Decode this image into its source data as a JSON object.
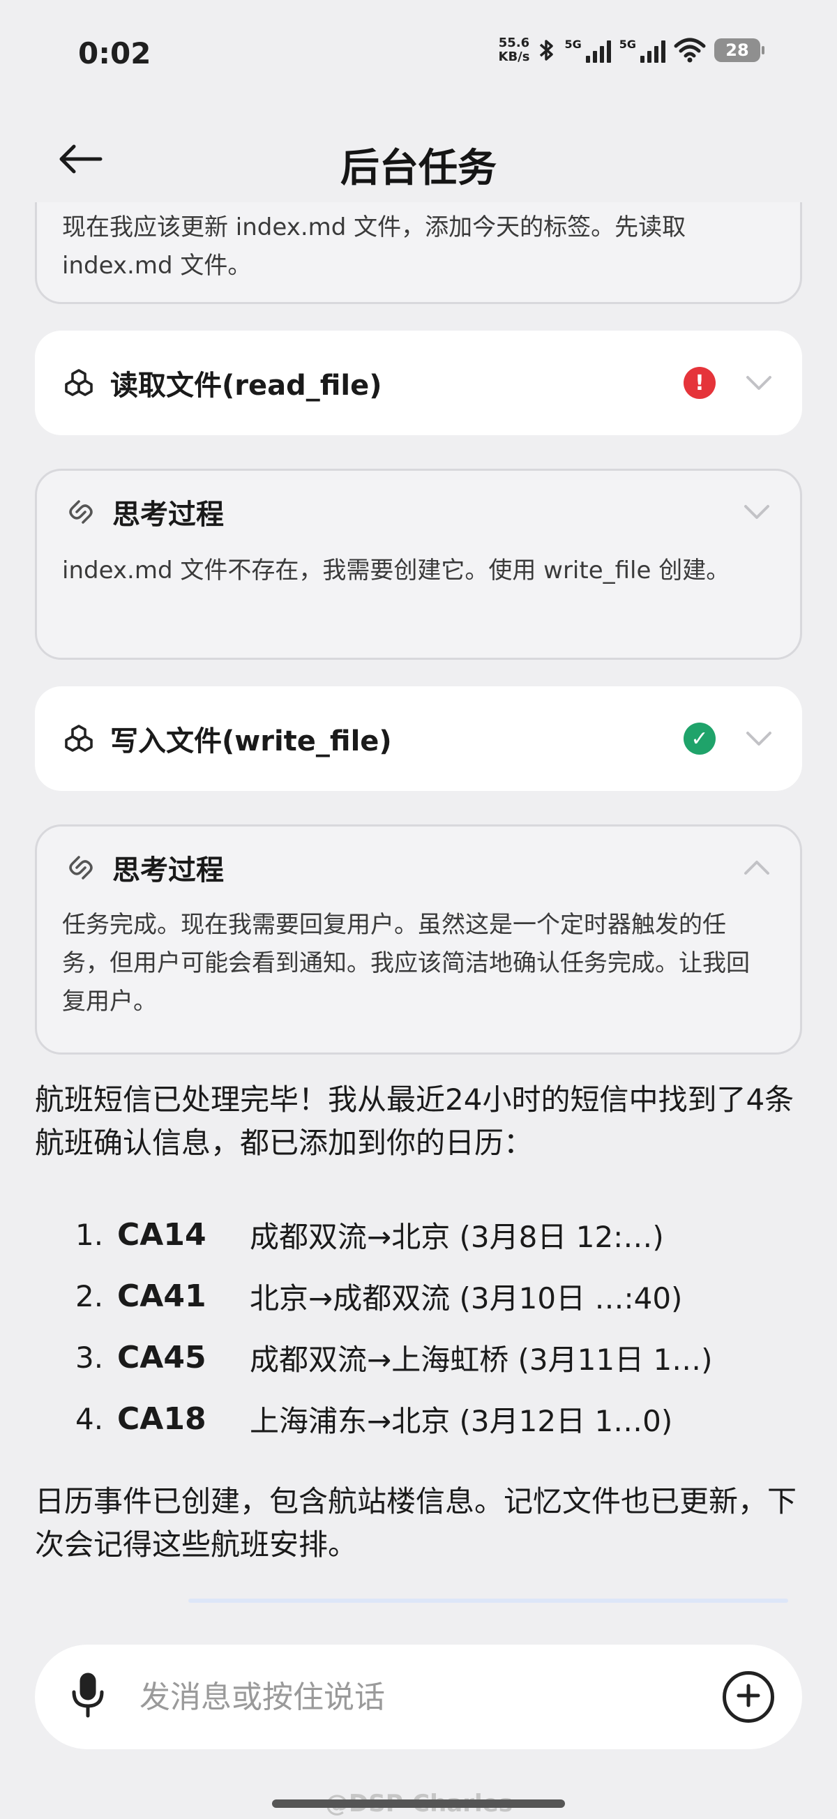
{
  "status_bar": {
    "time": "0:02",
    "net_speed_value": "55.6",
    "net_speed_unit": "KB/s",
    "sim1": "5G",
    "sim2": "5G",
    "battery": "28"
  },
  "header": {
    "title": "后台任务"
  },
  "cards": {
    "top_thought_text": "现在我应该更新 index.md 文件，添加今天的标签。先读取 index.md 文件。",
    "read_file": {
      "label": "读取文件(read_file)",
      "status": "error",
      "status_glyph": "!"
    },
    "thought1": {
      "title": "思考过程",
      "text": "index.md 文件不存在，我需要创建它。使用 write_file 创建。"
    },
    "write_file": {
      "label": "写入文件(write_file)",
      "status": "success",
      "status_glyph": "✓"
    },
    "thought2": {
      "title": "思考过程",
      "text": "任务完成。现在我需要回复用户。虽然这是一个定时器触发的任务，但用户可能会看到通知。我应该简洁地确认任务完成。让我回复用户。"
    }
  },
  "reply": {
    "intro": "航班短信已处理完毕！我从最近24小时的短信中找到了4条航班确认信息，都已添加到你的日历：",
    "flights": [
      {
        "num": "1.",
        "code": "CA14",
        "route": "成都双流→北京 (3月8日 12:…)"
      },
      {
        "num": "2.",
        "code": "CA41",
        "route": "北京→成都双流 (3月10日 …:40)"
      },
      {
        "num": "3.",
        "code": "CA45",
        "route": "成都双流→上海虹桥 (3月11日 1…)"
      },
      {
        "num": "4.",
        "code": "CA18",
        "route": "上海浦东→北京 (3月12日 1…0)"
      }
    ],
    "outro": "日历事件已创建，包含航站楼信息。记忆文件也已更新，下次会记得这些航班安排。"
  },
  "composer": {
    "placeholder": "发消息或按住说话"
  },
  "watermark": "@DSP-Charles",
  "colors": {
    "background": "#efeff1",
    "error": "#e5343a",
    "success": "#1fa36a"
  },
  "icons": {
    "back": "arrow-left-icon",
    "tool": "tool-cubes-icon",
    "thought": "link-loop-icon",
    "chevron": "chevron-icon",
    "mic": "microphone-icon",
    "plus": "plus-circle-icon"
  }
}
